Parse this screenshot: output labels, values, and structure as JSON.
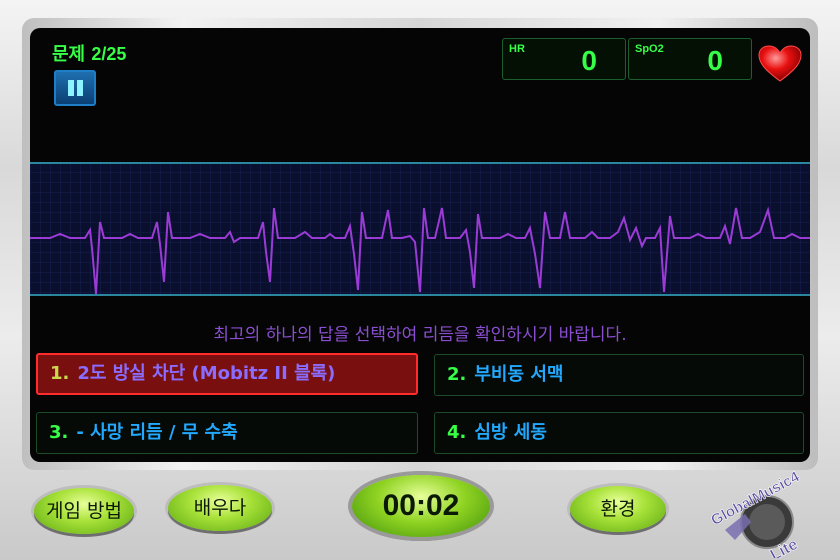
{
  "header": {
    "question_label": "문제",
    "question_progress": "2/25",
    "hr_label": "HR",
    "hr_value": "0",
    "spo2_label": "SpO2",
    "spo2_value": "0"
  },
  "prompt": "최고의 하나의 답을 선택하여 리듬을 확인하시기 바랍니다.",
  "options": [
    {
      "number": "1.",
      "text": "2도 방실 차단 (Mobitz II 블록)",
      "selected": true
    },
    {
      "number": "2.",
      "text": "부비동 서맥",
      "selected": false
    },
    {
      "number": "3.",
      "text": "- 사망 리듬 / 무 수축",
      "selected": false
    },
    {
      "number": "4.",
      "text": "심방 세동",
      "selected": false
    }
  ],
  "bottom_bar": {
    "how_to_play": "게임 방법",
    "learn": "배우다",
    "timer": "00:02",
    "settings": "환경"
  },
  "logo": {
    "line1": "GlobalMusic4",
    "line2": "Lite"
  },
  "colors": {
    "accent_green": "#37ff47",
    "ecg_trace": "#9b3bd6",
    "selected_border": "#ff2d2d",
    "option_text": "#22a9ff"
  }
}
